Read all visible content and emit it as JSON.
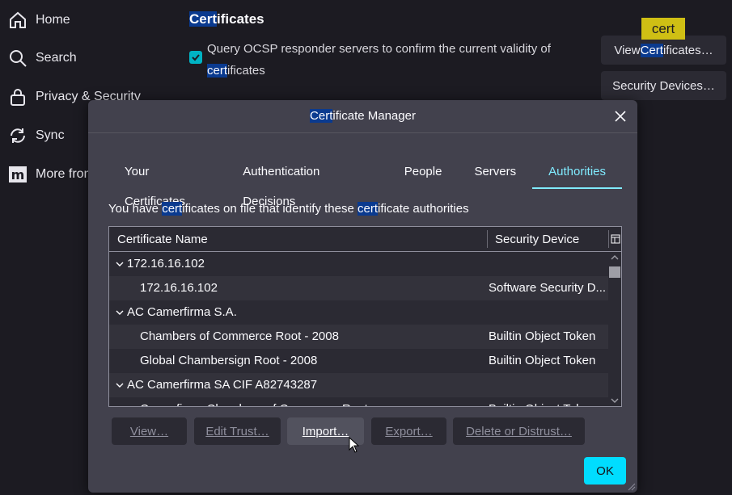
{
  "sidebar": {
    "items": [
      {
        "label": "Home"
      },
      {
        "label": "Search"
      },
      {
        "label": "Privacy & Security"
      },
      {
        "label": "Sync"
      },
      {
        "label": "More from"
      }
    ]
  },
  "background": {
    "section_hl": "Cert",
    "section_rest": "ificates",
    "query_pre": "Query OCSP responder servers to confirm the current validity of",
    "query_hl": "cert",
    "query_rest": "ificates",
    "tooltip": "cert",
    "view_pre": "View ",
    "view_hl": "Cert",
    "view_rest": "ificates…",
    "security_devices": "Security Devices…"
  },
  "dialog": {
    "title_hl": "Cert",
    "title_rest": "ificate Manager",
    "tabs": [
      {
        "label": "Your Certificates"
      },
      {
        "label": "Authentication Decisions"
      },
      {
        "label": "People"
      },
      {
        "label": "Servers"
      },
      {
        "label": "Authorities"
      }
    ],
    "intro": {
      "a": "You have ",
      "b": "cert",
      "c": "ificates on file that identify these ",
      "d": "cert",
      "e": "ificate authorities"
    },
    "columns": {
      "name": "Certificate Name",
      "device": "Security Device"
    },
    "rows": [
      {
        "name": "172.16.16.102",
        "device": ""
      },
      {
        "name": "172.16.16.102",
        "device": "Software Security D..."
      },
      {
        "name": "AC Camerfirma S.A.",
        "device": ""
      },
      {
        "name": "Chambers of Commerce Root - 2008",
        "device": "Builtin Object Token"
      },
      {
        "name": "Global Chambersign Root - 2008",
        "device": "Builtin Object Token"
      },
      {
        "name": "AC Camerfirma SA CIF A82743287",
        "device": ""
      },
      {
        "name": "Camerfirma Chambers of Commerce Root",
        "device": "Builtin Object Token"
      }
    ],
    "buttons": {
      "view": "View…",
      "edit_trust": "Edit Trust…",
      "import": "Import…",
      "export": "Export…",
      "delete": "Delete or Distrust…",
      "ok": "OK"
    }
  }
}
